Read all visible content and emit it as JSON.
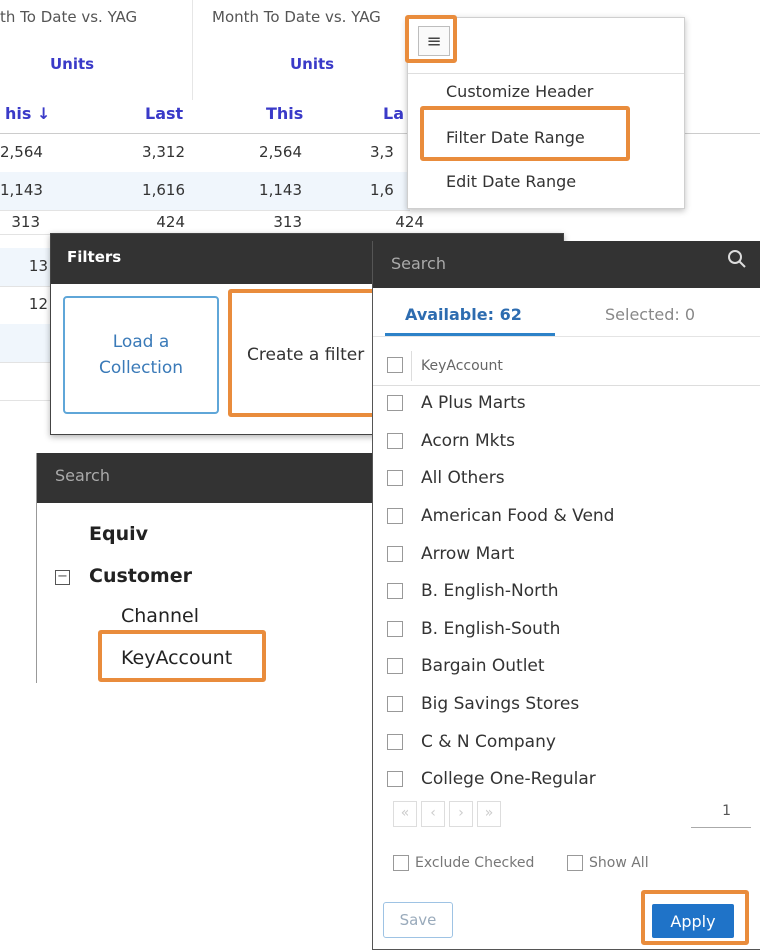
{
  "grid": {
    "col_headers": [
      "th To Date vs. YAG",
      "Month To Date vs. YAG"
    ],
    "units": [
      "Units",
      "Units"
    ],
    "sub_headers": [
      "his ↓",
      "Last",
      "This",
      "La"
    ],
    "rows": [
      [
        "2,564",
        "3,312",
        "2,564",
        "3,3"
      ],
      [
        "1,143",
        "1,616",
        "1,143",
        "1,6"
      ],
      [
        "313",
        "424",
        "313",
        "424"
      ],
      [
        "13",
        "",
        "",
        ""
      ],
      [
        "12",
        "",
        "",
        ""
      ],
      [
        "",
        "",
        "",
        ""
      ],
      [
        "",
        "",
        "",
        ""
      ]
    ]
  },
  "menu": {
    "icon": "hamburger-menu-icon",
    "items": [
      "Customize Header",
      "Filter Date Range",
      "Edit Date Range"
    ]
  },
  "filters": {
    "title": "Filters",
    "load_label_1": "Load a",
    "load_label_2": "Collection",
    "create_label": "Create a filter"
  },
  "tree": {
    "search_placeholder": "Search",
    "nodes": [
      "Equiv",
      "Customer",
      "Channel",
      "KeyAccount"
    ]
  },
  "values": {
    "search_placeholder": "Search",
    "search_icon": "search-icon",
    "tab_available": "Available: 62",
    "tab_selected": "Selected: 0",
    "column_header": "KeyAccount",
    "items": [
      "A Plus Marts",
      "Acorn Mkts",
      "All Others",
      "American Food & Vend",
      "Arrow Mart",
      "B. English-North",
      "B. English-South",
      "Bargain Outlet",
      "Big Savings Stores",
      "C & N Company",
      "College One-Regular"
    ],
    "pager": [
      "«",
      "‹",
      "›",
      "»"
    ],
    "page_number": "1",
    "exclude_label": "Exclude Checked",
    "show_all_label": "Show All",
    "save_label": "Save",
    "apply_label": "Apply"
  },
  "colors": {
    "highlight": "#e98c3c",
    "dark_bar": "#333333",
    "link_blue": "#3a3ac8",
    "apply_blue": "#1f73c8"
  }
}
